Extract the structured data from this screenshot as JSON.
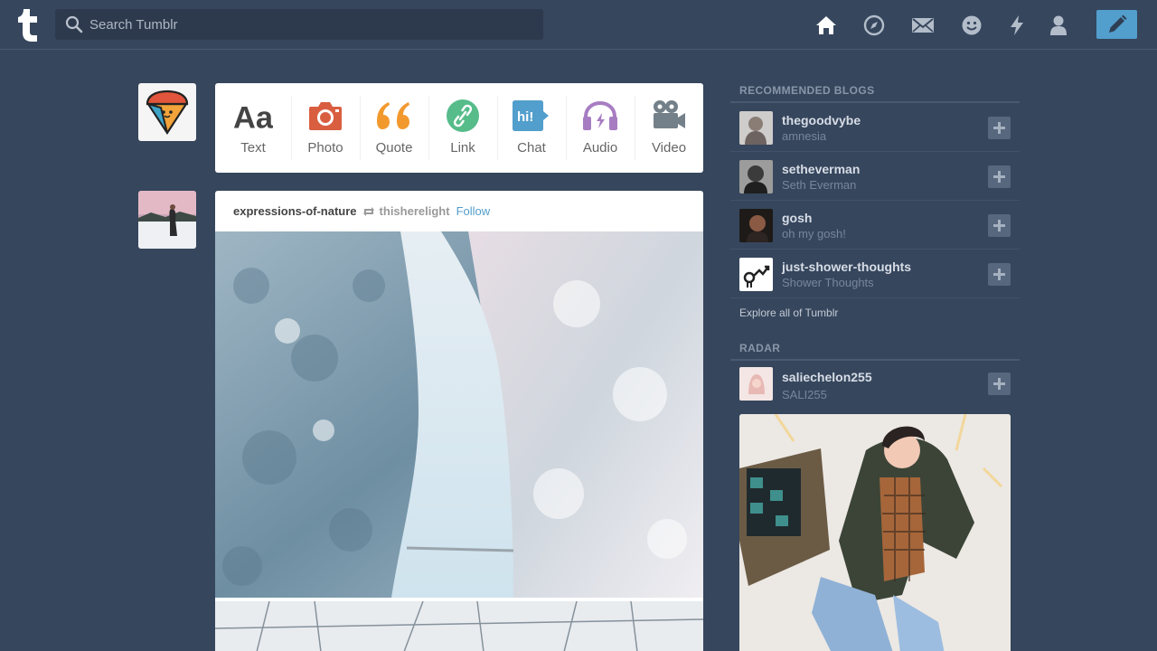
{
  "app": {
    "brand_color": "#36465d",
    "accent_color": "#529ecc"
  },
  "header": {
    "search_placeholder": "Search Tumblr",
    "nav_icons": [
      "home-icon",
      "explore-icon",
      "inbox-icon",
      "messaging-icon",
      "activity-icon",
      "account-icon"
    ],
    "compose_icon": "pencil-icon"
  },
  "composer": {
    "types": [
      {
        "label": "Text",
        "icon": "text-icon",
        "color": "#444444"
      },
      {
        "label": "Photo",
        "icon": "camera-icon",
        "color": "#d95e40"
      },
      {
        "label": "Quote",
        "icon": "quote-icon",
        "color": "#f2992e"
      },
      {
        "label": "Link",
        "icon": "link-icon",
        "color": "#56bc8a"
      },
      {
        "label": "Chat",
        "icon": "chat-icon",
        "color": "#529ecc"
      },
      {
        "label": "Audio",
        "icon": "headphones-icon",
        "color": "#a77dc2"
      },
      {
        "label": "Video",
        "icon": "video-camera-icon",
        "color": "#748089"
      }
    ]
  },
  "post": {
    "blog_name": "expressions-of-nature",
    "reblog_source": "thisherelight",
    "follow_label": "Follow"
  },
  "sidebar": {
    "recommended_heading": "RECOMMENDED BLOGS",
    "recommended": [
      {
        "name": "thegoodvybe",
        "title": "amnesia"
      },
      {
        "name": "setheverman",
        "title": "Seth Everman"
      },
      {
        "name": "gosh",
        "title": "oh my gosh!"
      },
      {
        "name": "just-shower-thoughts",
        "title": "Shower Thoughts"
      }
    ],
    "explore_label": "Explore all of Tumblr",
    "radar_heading": "RADAR",
    "radar": {
      "name": "saliechelon255",
      "title": "SALI255"
    }
  }
}
